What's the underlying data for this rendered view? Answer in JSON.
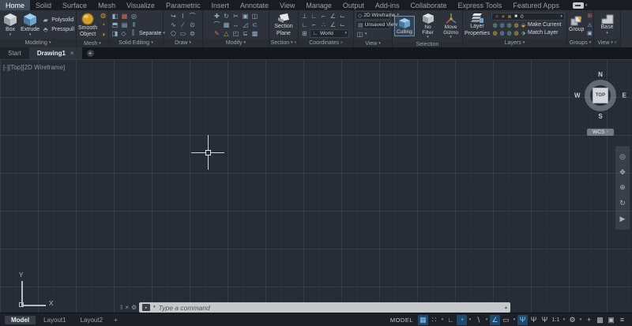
{
  "ui": {
    "caret_down": "▾",
    "caret_up": "▴",
    "overflow": "»",
    "close": "×"
  },
  "colors": {
    "accent_blue": "#4a90d9",
    "canvas_bg": "#262c35",
    "gold": "#d4a02a",
    "active_icon_bg": "#1e4a6d"
  },
  "ribbon_tabs": [
    {
      "name": "tab-home",
      "label": "Home",
      "active": true
    },
    {
      "name": "tab-solid",
      "label": "Solid"
    },
    {
      "name": "tab-surface",
      "label": "Surface"
    },
    {
      "name": "tab-mesh",
      "label": "Mesh"
    },
    {
      "name": "tab-visualize",
      "label": "Visualize"
    },
    {
      "name": "tab-parametric",
      "label": "Parametric"
    },
    {
      "name": "tab-insert",
      "label": "Insert"
    },
    {
      "name": "tab-annotate",
      "label": "Annotate"
    },
    {
      "name": "tab-view",
      "label": "View"
    },
    {
      "name": "tab-manage",
      "label": "Manage"
    },
    {
      "name": "tab-output",
      "label": "Output"
    },
    {
      "name": "tab-addins",
      "label": "Add-ins"
    },
    {
      "name": "tab-collaborate",
      "label": "Collaborate"
    },
    {
      "name": "tab-express-tools",
      "label": "Express Tools"
    },
    {
      "name": "tab-featured-apps",
      "label": "Featured Apps"
    }
  ],
  "panels": {
    "modeling": {
      "label": "Modeling",
      "box": "Box",
      "extrude": "Extrude",
      "polysolid": "Polysolid",
      "presspull": "Presspull"
    },
    "mesh": {
      "label": "Mesh",
      "smooth_object": "Smooth\nObject",
      "side_icons": [
        {
          "name": "smooth-more-icon",
          "glyph": "◍",
          "color": "#d4a02a"
        },
        {
          "name": "smooth-less-icon",
          "glyph": "◔",
          "color": "#d4a02a"
        },
        {
          "name": "refine-mesh-icon",
          "glyph": "◑",
          "color": "#d4a02a"
        }
      ]
    },
    "solid_editing": {
      "label": "Solid Editing",
      "separate": "Separate",
      "row1": [
        {
          "name": "union-icon",
          "glyph": "◧"
        },
        {
          "name": "subtract-icon",
          "glyph": "▦",
          "color": "#c96a5a"
        },
        {
          "name": "intersect-icon",
          "glyph": "◎"
        }
      ],
      "row2": [
        {
          "name": "slice-icon",
          "glyph": "⬒"
        },
        {
          "name": "thicken-icon",
          "glyph": "▤"
        },
        {
          "name": "interfere-icon",
          "glyph": "‖"
        }
      ],
      "row3": [
        {
          "name": "extract-edges-icon",
          "glyph": "◨"
        },
        {
          "name": "shell-icon",
          "glyph": "◇"
        }
      ]
    },
    "draw": {
      "label": "Draw",
      "row1": [
        {
          "name": "revision-cloud-icon",
          "glyph": "↪"
        },
        {
          "name": "polyline-icon",
          "glyph": "⌇"
        },
        {
          "name": "arc-icon",
          "glyph": "⌒"
        }
      ],
      "row2": [
        {
          "name": "spline-icon",
          "glyph": "∿"
        },
        {
          "name": "line-icon",
          "glyph": "∕"
        },
        {
          "name": "circle-icon",
          "glyph": "⊙"
        }
      ],
      "row3": [
        {
          "name": "polygon-icon",
          "glyph": "⬠"
        },
        {
          "name": "rectangle-icon",
          "glyph": "▭"
        },
        {
          "name": "ellipse-icon",
          "glyph": "⊜"
        }
      ]
    },
    "modify": {
      "label": "Modify",
      "row1": [
        {
          "name": "move-icon",
          "glyph": "✚"
        },
        {
          "name": "rotate-icon",
          "glyph": "↻"
        },
        {
          "name": "trim-icon",
          "glyph": "✂"
        },
        {
          "name": "copy-icon",
          "glyph": "▣"
        },
        {
          "name": "mirror-icon",
          "glyph": "◫"
        }
      ],
      "row2": [
        {
          "name": "fillet-icon",
          "glyph": "⌒"
        },
        {
          "name": "array-icon",
          "glyph": "▦"
        },
        {
          "name": "stretch-icon",
          "glyph": "↔"
        },
        {
          "name": "scale-icon",
          "glyph": "◿"
        },
        {
          "name": "offset-icon",
          "glyph": "⊂"
        }
      ],
      "row3": [
        {
          "name": "erase-icon",
          "glyph": "✎",
          "color": "#c96a5a"
        },
        {
          "name": "explode-icon",
          "glyph": "△",
          "color": "#d4a02a"
        },
        {
          "name": "align-icon",
          "glyph": "◰"
        },
        {
          "name": "join-icon",
          "glyph": "⊆"
        },
        {
          "name": "array-options-icon",
          "glyph": "▩"
        }
      ]
    },
    "section": {
      "label": "Section",
      "plane": "Section\nPlane"
    },
    "coordinates": {
      "label": "Coordinates",
      "world": "World",
      "row1": [
        {
          "name": "ucs-icon",
          "glyph": "⊥"
        },
        {
          "name": "ucs-previous-icon",
          "glyph": "∟"
        },
        {
          "name": "ucs-face-icon",
          "glyph": "⌐"
        },
        {
          "name": "ucs-object-icon",
          "glyph": "∠"
        },
        {
          "name": "ucs-view-icon",
          "glyph": "⌙"
        }
      ],
      "row2": [
        {
          "name": "ucs-origin-icon",
          "glyph": "∟"
        },
        {
          "name": "ucs-zaxis-icon",
          "glyph": "⌐"
        },
        {
          "name": "ucs-3point-icon",
          "glyph": "∴"
        },
        {
          "name": "ucs-x-icon",
          "glyph": "∠"
        },
        {
          "name": "ucs-y-icon",
          "glyph": "⌙"
        }
      ],
      "row3_icon": {
        "name": "ucs-named-icon",
        "glyph": "⊞"
      }
    },
    "view": {
      "label": "View",
      "visual_style": "2D Wireframe",
      "named_view": "Unsaved View",
      "extra_icon": {
        "name": "viewport-config-icon",
        "glyph": "◫"
      }
    },
    "selection": {
      "label": "Selection",
      "culling": "Culling",
      "no_filter": "No Filter",
      "move_gizmo": "Move\nGizmo"
    },
    "layers": {
      "label": "Layers",
      "layer_properties": "Layer\nProperties",
      "current_layer": "0",
      "make_current": "Make Current",
      "match_layer": "Match Layer",
      "combo_icons": [
        {
          "name": "layer-on-icon",
          "glyph": "☼",
          "color": "#d4a02a"
        },
        {
          "name": "layer-thaw-icon",
          "glyph": "☀",
          "color": "#d4a02a"
        },
        {
          "name": "layer-unlock-icon",
          "glyph": "⋒",
          "color": "#d4a02a"
        },
        {
          "name": "layer-color-icon",
          "glyph": "■",
          "color": "#e8e8e8"
        }
      ],
      "row1": [
        {
          "name": "layer-off-icon",
          "glyph": "◍",
          "color": "#76b5a0"
        },
        {
          "name": "layer-isolate-icon",
          "glyph": "◍",
          "color": "#7aa7d9"
        },
        {
          "name": "layer-freeze-icon",
          "glyph": "◍",
          "color": "#76b5a0"
        },
        {
          "name": "layer-lock-icon",
          "glyph": "◍",
          "color": "#d9b44a"
        },
        {
          "name": "make-current-icon",
          "glyph": "⬙",
          "color": "#d9b44a"
        }
      ],
      "row2": [
        {
          "name": "layer-on-all-icon",
          "glyph": "◍",
          "color": "#d9b44a"
        },
        {
          "name": "layer-unisolate-icon",
          "glyph": "◍",
          "color": "#7aa7d9"
        },
        {
          "name": "layer-thaw-all-icon",
          "glyph": "◍",
          "color": "#76b5a0"
        },
        {
          "name": "layer-unlock-all-icon",
          "glyph": "◍",
          "color": "#d9b44a"
        },
        {
          "name": "match-layer-icon",
          "glyph": "⬗",
          "color": "#76b5a0"
        }
      ]
    },
    "groups": {
      "label": "Groups",
      "group": "Group",
      "side_icons": [
        {
          "name": "ungroup-icon",
          "glyph": "⊞",
          "color": "#c96a5a"
        },
        {
          "name": "group-edit-icon",
          "glyph": "◬",
          "color": "#7aa7d9"
        },
        {
          "name": "group-selection-icon",
          "glyph": "▣",
          "color": "#8fc3ef",
          "active": true
        }
      ]
    },
    "view2": {
      "label": "View",
      "base": "Base"
    }
  },
  "file_tabs": {
    "start": "Start",
    "drawing": "Drawing1",
    "close": "×",
    "new_tab": "+"
  },
  "viewport": {
    "label": "[-][Top][2D Wireframe]"
  },
  "viewcube": {
    "n": "N",
    "s": "S",
    "e": "E",
    "w": "W",
    "top": "TOP",
    "wcs": "WCS"
  },
  "navbar_icons": [
    {
      "name": "navigation-wheel-icon",
      "glyph": "◎"
    },
    {
      "name": "pan-icon",
      "glyph": "✥"
    },
    {
      "name": "zoom-extents-icon",
      "glyph": "⊕"
    },
    {
      "name": "orbit-icon",
      "glyph": "↻"
    },
    {
      "name": "showmotion-icon",
      "glyph": "▶"
    }
  ],
  "ucs_icon": {
    "x": "X",
    "y": "Y"
  },
  "command": {
    "placeholder": "Type a command",
    "close": "×"
  },
  "status": {
    "model_tab": "Model",
    "layout1": "Layout1",
    "layout2": "Layout2",
    "new_layout": "+",
    "model_space": "MODEL",
    "annotation_scale": "1:1",
    "icons": [
      {
        "name": "grid-icon",
        "glyph": "▦",
        "active": true
      },
      {
        "name": "snap-icon",
        "glyph": "∷"
      },
      {
        "name": "snap-caret",
        "glyph": "▾",
        "kind": "caret"
      },
      {
        "name": "ortho-icon",
        "glyph": "∟"
      },
      {
        "name": "polar-tracking-icon",
        "glyph": "◔",
        "active": true
      },
      {
        "name": "polar-caret",
        "glyph": "▾",
        "kind": "caret"
      },
      {
        "name": "isodraft-icon",
        "glyph": "∖"
      },
      {
        "name": "isodraft-caret",
        "glyph": "▾",
        "kind": "caret"
      },
      {
        "name": "osnap-icon",
        "glyph": "∠",
        "active": true
      },
      {
        "name": "dynamic-input-icon",
        "glyph": "▭"
      },
      {
        "name": "osnap-caret",
        "glyph": "▾",
        "kind": "caret"
      },
      {
        "name": "annotation-visibility-icon",
        "glyph": "Ψ",
        "active": true
      },
      {
        "name": "annotation-autoscale-icon",
        "glyph": "Ψ"
      },
      {
        "name": "annotation-scale-icon",
        "glyph": "Ψ"
      },
      {
        "name": "annotation-scale-value",
        "glyph": "1:1",
        "kind": "text"
      },
      {
        "name": "scale-caret",
        "glyph": "▾",
        "kind": "caret"
      },
      {
        "name": "workspace-gear-icon",
        "glyph": "⚙"
      },
      {
        "name": "workspace-caret",
        "glyph": "▾",
        "kind": "caret"
      },
      {
        "name": "customization-plus-icon",
        "glyph": "+"
      },
      {
        "name": "isolate-objects-icon",
        "glyph": "▩"
      },
      {
        "name": "graphics-performance-icon",
        "glyph": "▣"
      },
      {
        "name": "customization-menu-icon",
        "glyph": "≡"
      }
    ]
  }
}
